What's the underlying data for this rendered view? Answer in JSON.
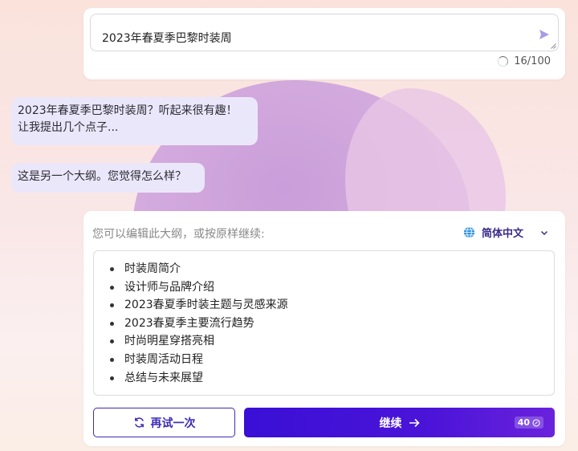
{
  "prompt": {
    "value": "2023年春夏季巴黎时装周",
    "counter": "16/100",
    "send_icon": "send-arrow-icon"
  },
  "chat": {
    "messages": [
      {
        "lines": [
          "2023年春夏季巴黎时装周？听起来很有趣！",
          "让我提出几个点子..."
        ]
      },
      {
        "lines": [
          "这是另一个大纲。您觉得怎么样？"
        ]
      }
    ]
  },
  "outline": {
    "hint": "您可以编辑此大纲，或按原样继续:",
    "language": "简体中文",
    "items": [
      "时装周简介",
      "设计师与品牌介绍",
      "2023春夏季时装主题与灵感来源",
      "2023春夏季主要流行趋势",
      "时尚明星穿搭亮相",
      "时装周活动日程",
      "总结与未来展望"
    ]
  },
  "actions": {
    "retry_label": "再试一次",
    "continue_label": "继续",
    "credits": "40"
  },
  "colors": {
    "accent": "#3d2bb8",
    "button_gradient_start": "#3a0fd6",
    "button_gradient_end": "#6a22dc",
    "bubble_bg": "#ebe7fb"
  }
}
